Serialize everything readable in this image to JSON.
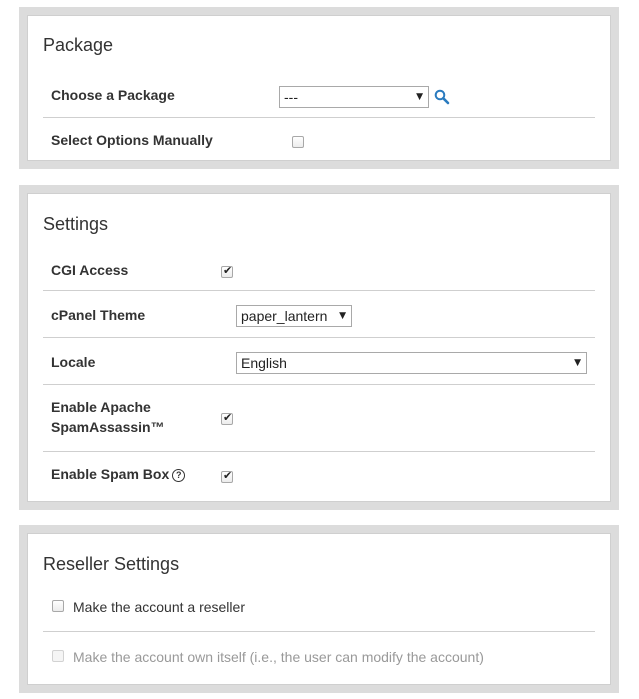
{
  "package": {
    "title": "Package",
    "choose_label": "Choose a Package",
    "choose_value": "---",
    "manual_label": "Select Options Manually",
    "manual_checked": false
  },
  "settings": {
    "title": "Settings",
    "cgi_label": "CGI Access",
    "cgi_checked": true,
    "theme_label": "cPanel Theme",
    "theme_value": "paper_lantern",
    "locale_label": "Locale",
    "locale_value": "English",
    "spamassassin_label": "Enable Apache SpamAssassin™",
    "spamassassin_checked": true,
    "spambox_label": "Enable Spam Box",
    "spambox_checked": true,
    "help_glyph": "?"
  },
  "reseller": {
    "title": "Reseller Settings",
    "make_reseller_label": "Make the account a reseller",
    "make_reseller_checked": false,
    "own_itself_label": "Make the account own itself (i.e., the user can modify the account)",
    "own_itself_checked": false,
    "own_itself_disabled": true
  },
  "icons": {
    "dropdown_arrow": "▼",
    "search": "search-icon",
    "checkmark": "✔"
  },
  "colors": {
    "panel_border": "#cfcfcf",
    "outer_frame": "#dcdcdc",
    "search_blue": "#2a7bbf"
  }
}
